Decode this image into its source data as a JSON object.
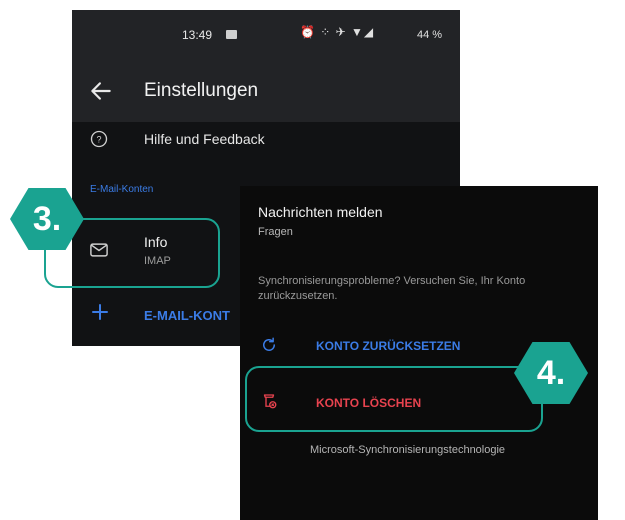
{
  "left_screen": {
    "status_bar": {
      "time": "13:49",
      "icons_text": "⏰ ⁘ ✈ ▼◢",
      "battery": "44 %"
    },
    "appbar": {
      "title": "Einstellungen"
    },
    "help": {
      "label": "Hilfe und Feedback"
    },
    "accounts_header": "E-Mail-Konten",
    "account": {
      "name": "Info",
      "type": "IMAP"
    },
    "add_account_label": "E-MAIL-KONT"
  },
  "right_screen": {
    "report_title": "Nachrichten melden",
    "report_sub": "Fragen",
    "sync_text": "Synchronisierungsprobleme? Versuchen Sie, Ihr Konto zurückzusetzen.",
    "reset_label": "KONTO ZURÜCKSETZEN",
    "delete_label": "KONTO LÖSCHEN",
    "tech_label": "Microsoft-Synchronisierungstechnologie"
  },
  "badges": {
    "step3": "3.",
    "step4": "4."
  },
  "colors": {
    "accent_teal": "#1aa391",
    "link_blue": "#3b7ce6",
    "danger_red": "#e8434f",
    "dark_bg": "#111214"
  }
}
